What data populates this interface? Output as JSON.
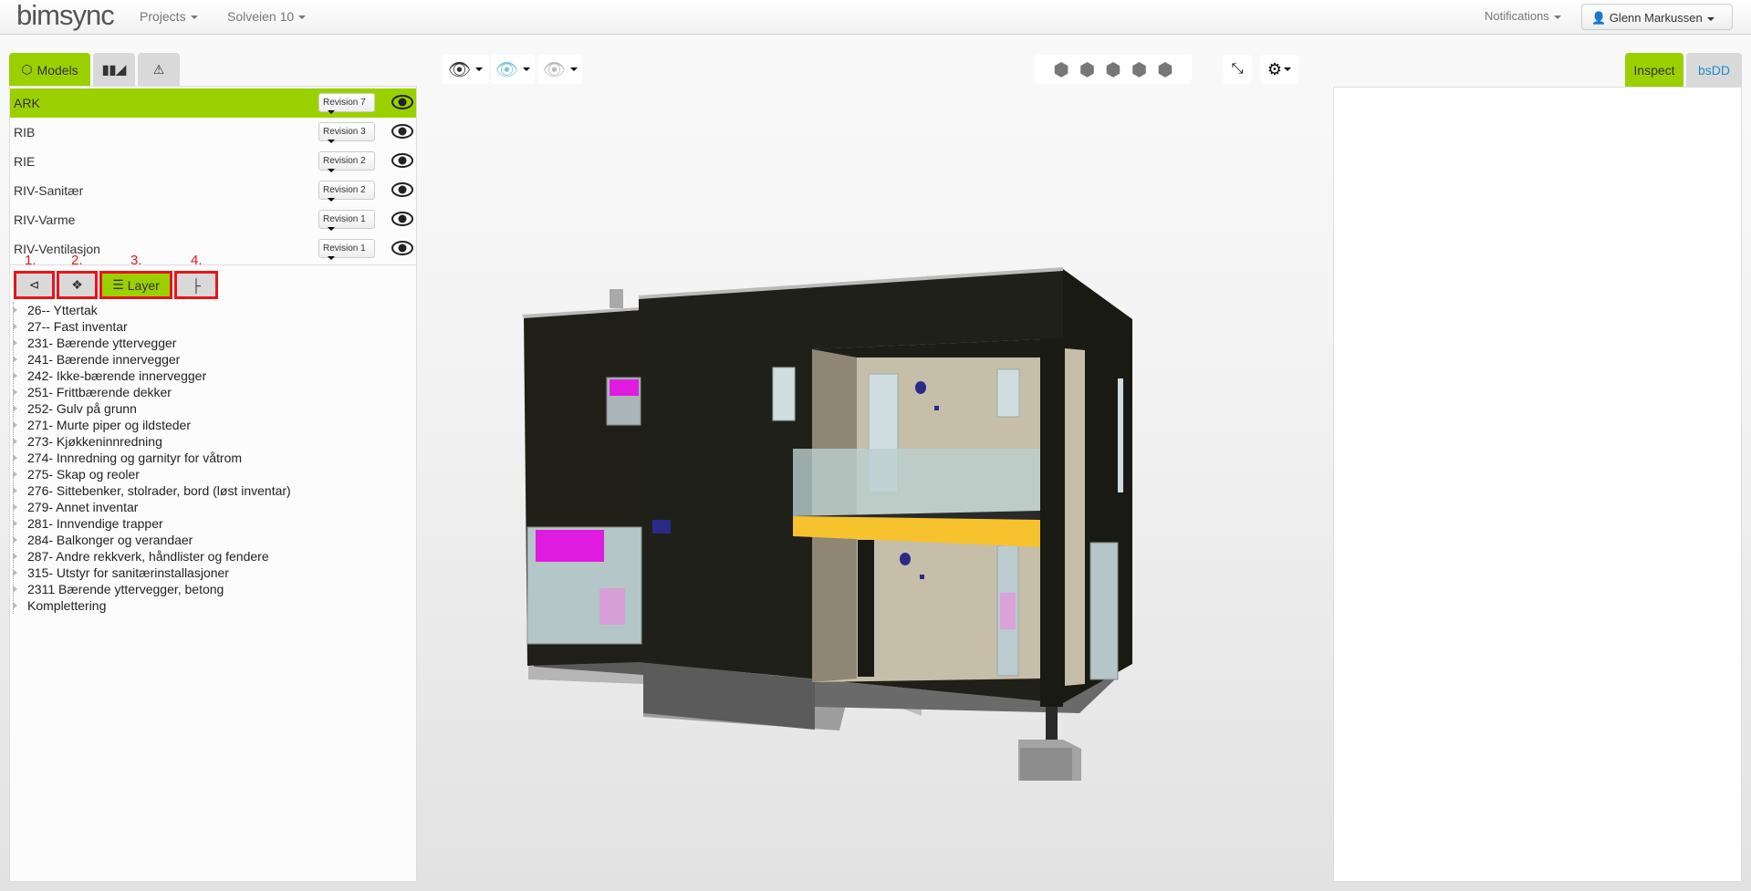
{
  "navbar": {
    "logo": "bimsync",
    "projects": "Projects",
    "project": "Solveien 10",
    "notifications": "Notifications",
    "user": "Glenn Markussen"
  },
  "left_tabs": [
    {
      "label": "Models",
      "icon": "cube-icon"
    },
    {
      "label": "",
      "icon": "books-icon"
    },
    {
      "label": "",
      "icon": "warning-icon"
    }
  ],
  "models": [
    {
      "name": "ARK",
      "revision": "Revision 7",
      "selected": true
    },
    {
      "name": "RIB",
      "revision": "Revision 3"
    },
    {
      "name": "RIE",
      "revision": "Revision 2"
    },
    {
      "name": "RIV-Sanitær",
      "revision": "Revision 2"
    },
    {
      "name": "RIV-Varme",
      "revision": "Revision 1"
    },
    {
      "name": "RIV-Ventilasjon",
      "revision": "Revision 1"
    }
  ],
  "view_buttons": [
    {
      "num": "1.",
      "icon": "hierarchy-icon"
    },
    {
      "num": "2.",
      "icon": "puzzle-icon"
    },
    {
      "num": "3.",
      "icon": "layers-icon",
      "label": "Layer",
      "active": true
    },
    {
      "num": "4.",
      "icon": "tree-icon"
    }
  ],
  "tree": [
    "26-- Yttertak",
    "27-- Fast inventar",
    "231- Bærende yttervegger",
    "241- Bærende innervegger",
    "242- Ikke-bærende innervegger",
    "251- Frittbærende dekker",
    "252- Gulv på grunn",
    "271- Murte piper og ildsteder",
    "273- Kjøkkeninnredning",
    "274- Innredning og garnityr for våtrom",
    "275- Skap og reoler",
    "276- Sittebenker, stolrader, bord (løst inventar)",
    "279- Annet inventar",
    "281- Innvendige trapper",
    "284- Balkonger og verandaer",
    "287- Andre rekkverk, håndlister og fendere",
    "315- Utstyr for sanitærinstallasjoner",
    "2311 Bærende yttervegger, betong",
    "Komplettering"
  ],
  "right_tabs": [
    {
      "label": "Inspect",
      "active": true
    },
    {
      "label": "bsDD"
    }
  ],
  "colors": {
    "accent": "#9bd000",
    "annotation": "#e8141c",
    "link": "#1a8fd0"
  }
}
